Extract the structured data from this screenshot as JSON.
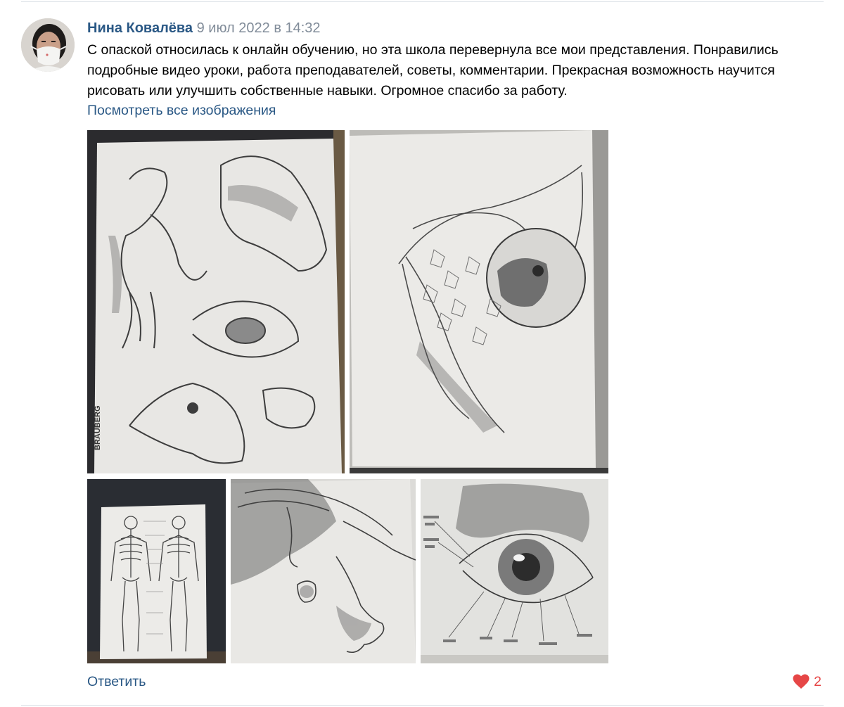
{
  "comment": {
    "author": "Нина Ковалёва",
    "date": "9 июл 2022 в 14:32",
    "text": "С опаской относилась к онлайн обучению, но эта школа перевернула все мои представления. Понравились подробные видео уроки, работа преподавателей, советы, комментарии. Прекрасная возможность научится рисовать или улучшить собственные навыки. Огромное спасибо за работу.",
    "view_all_link": "Посмотреть все изображения",
    "reply_label": "Ответить",
    "likes_count": "2",
    "photo_watermark": "BRAUBERG"
  },
  "colors": {
    "link": "#2a5885",
    "date": "#818c99",
    "like": "#e64646",
    "divider": "#dce1e6"
  },
  "icons": {
    "like": "heart-icon",
    "avatar": "avatar"
  }
}
